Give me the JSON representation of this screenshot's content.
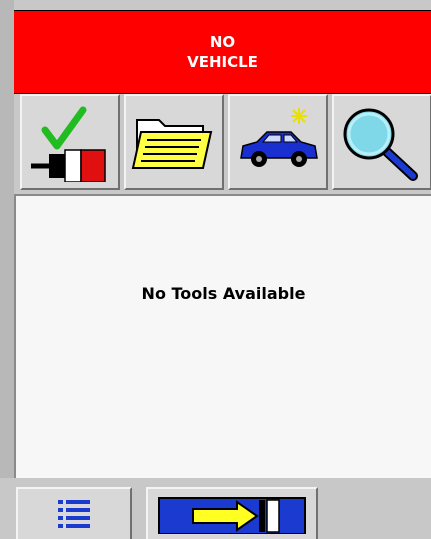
{
  "header": {
    "line1": "NO",
    "line2": "VEHICLE",
    "color": "#ff0000"
  },
  "toolbar": {
    "buttons": [
      {
        "name": "connect",
        "icon": "connector-check-icon"
      },
      {
        "name": "open-folder",
        "icon": "folder-icon"
      },
      {
        "name": "vehicle-select",
        "icon": "car-icon"
      },
      {
        "name": "search",
        "icon": "magnifier-icon"
      }
    ]
  },
  "content": {
    "message": "No Tools Available"
  },
  "bottombar": {
    "buttons": [
      {
        "name": "menu",
        "icon": "list-icon"
      },
      {
        "name": "exit",
        "icon": "exit-arrow-icon"
      }
    ]
  }
}
